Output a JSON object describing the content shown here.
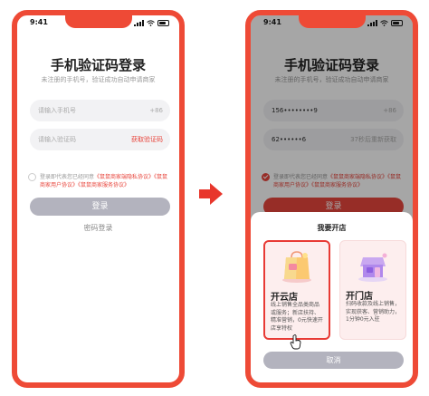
{
  "status": {
    "time": "9:41"
  },
  "login": {
    "title": "手机验证码登录",
    "subtitle": "未注册的手机号，验证成功自动申请商家",
    "phone": {
      "placeholder": "请输入手机号",
      "country_code": "+86"
    },
    "code": {
      "placeholder": "请输入验证码",
      "get_code_label": "获取验证码"
    },
    "agreement": {
      "prefix": "登录即代表您已经同意",
      "link1": "《鼠鼠商家端隐私协议》",
      "link2": "《鼠鼠商家用户协议》",
      "link3": "《鼠鼠商家服务协议》"
    },
    "login_button": "登录",
    "password_login": "密码登录"
  },
  "filled": {
    "phone_value": "156••••••••9",
    "code_value": "62••••••6",
    "countdown": "37秒后重新获取"
  },
  "sheet": {
    "title": "我要开店",
    "options": [
      {
        "name": "开云店",
        "desc": "线上销售全品类商品或服务；新店扶持、精准营销，0元快速开店享特权"
      },
      {
        "name": "开门店",
        "desc": "扫码收款及线上销售，实现获客、营销助力，1分钟0元入驻"
      }
    ],
    "cancel": "取消"
  },
  "colors": {
    "accent": "#e8453c",
    "frame": "#ee4a36",
    "disabled": "#b3b3be"
  }
}
